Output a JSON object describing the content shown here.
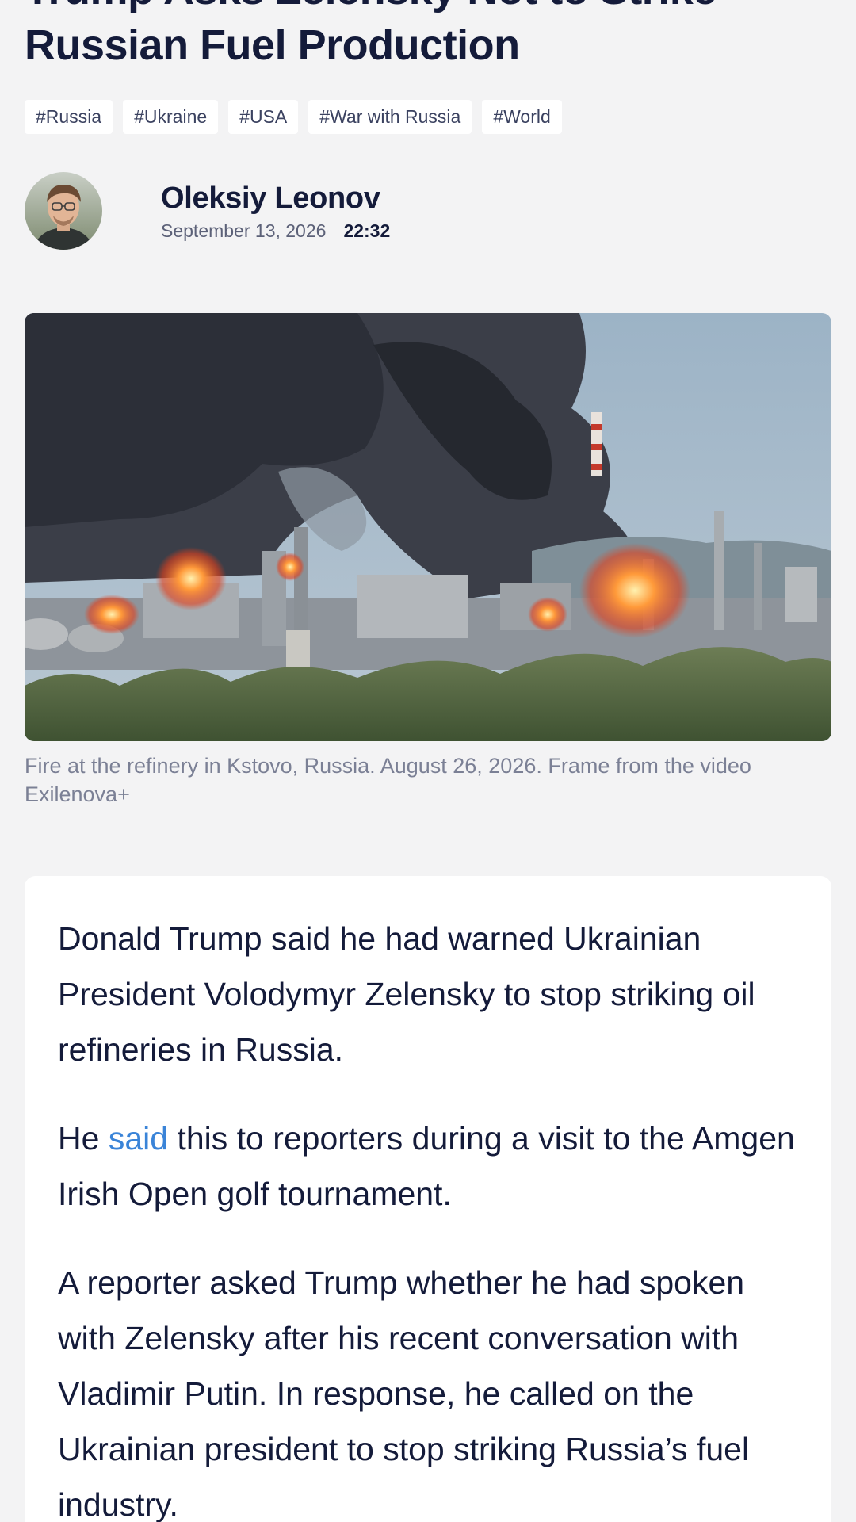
{
  "article": {
    "title": "Trump Asks Zelensky Not to Strike Russian Fuel Production",
    "tags": [
      "#Russia",
      "#Ukraine",
      "#USA",
      "#War with Russia",
      "#World"
    ],
    "author": {
      "name": "Oleksiy Leonov",
      "date": "September 13, 2026",
      "time": "22:32"
    },
    "image_caption": "Fire at the refinery in Kstovo, Russia. August 26, 2026. Frame from the video Exilenova+",
    "body": {
      "p1": "Donald Trump said he had warned Ukrainian President Volodymyr Zelensky to stop striking oil refineries in Russia.",
      "p2_before": "He ",
      "p2_link": "said",
      "p2_after": " this to reporters during a visit to the Amgen Irish Open golf tournament.",
      "p3": "A reporter asked Trump whether he had spoken with Zelensky after his recent conversation with Vladimir Putin. In response, he called on the Ukrainian president to stop striking Russia’s fuel industry."
    }
  },
  "colors": {
    "background": "#f3f3f4",
    "text": "#141b3a",
    "link": "#3a84d8",
    "caption": "#7b8095"
  }
}
